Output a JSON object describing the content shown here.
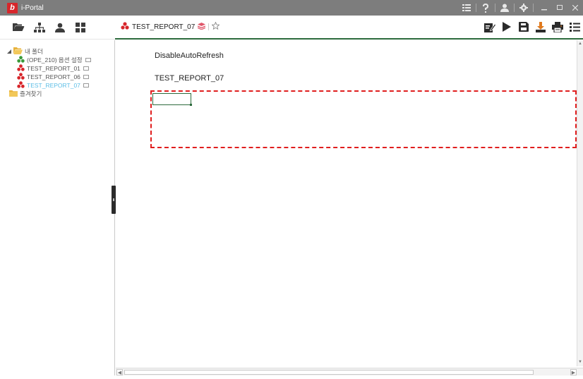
{
  "window": {
    "title": "i-Portal",
    "logo_letter": "b"
  },
  "tab": {
    "label": "TEST_REPORT_07"
  },
  "tree": {
    "root_label": "내 폴더",
    "items": [
      {
        "label": "(OPE_210) 옵션 설정",
        "icon_color": "#3a9a3a",
        "selected": false
      },
      {
        "label": "TEST_REPORT_01",
        "icon_color": "#d7262b",
        "selected": false
      },
      {
        "label": "TEST_REPORT_06",
        "icon_color": "#d7262b",
        "selected": false
      },
      {
        "label": "TEST_REPORT_07",
        "icon_color": "#d7262b",
        "selected": true
      }
    ],
    "favorites_label": "즐겨찾기"
  },
  "report": {
    "line1": "DisableAutoRefresh",
    "line2": "TEST_REPORT_07"
  },
  "colors": {
    "titlebar": "#7d7d7d",
    "accent_green": "#2d6b3d",
    "dashed_highlight": "#e01e1e",
    "selected_text": "#5bbde6"
  }
}
